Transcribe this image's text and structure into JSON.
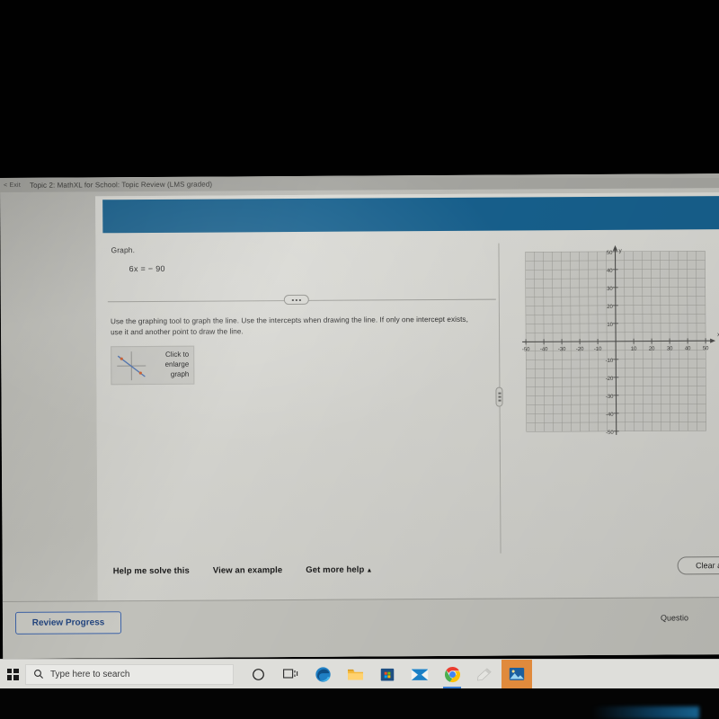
{
  "header": {
    "exit_label": "< Exit",
    "topic_title": "Topic 2: MathXL for School: Topic Review (LMS graded)"
  },
  "question": {
    "prompt": "Graph.",
    "equation": "6x = − 90",
    "instructions": "Use the graphing tool to graph the line. Use the intercepts when drawing the line. If only one intercept exists, use it and another point to draw the line.",
    "more_options_icon": "ellipsis-icon"
  },
  "enlarge_button": {
    "label": "Click to\nenlarge\ngraph",
    "line1": "Click to",
    "line2": "enlarge",
    "line3": "graph",
    "thumbnail_icon": "mini-graph-icon"
  },
  "splitter": {
    "icon": "drag-handle-icon"
  },
  "graph_tools": [
    {
      "name": "graph-tool-1",
      "glyph": "✎"
    },
    {
      "name": "graph-tool-2",
      "glyph": "•"
    },
    {
      "name": "graph-tool-3",
      "glyph": "↺"
    }
  ],
  "actions": {
    "help_me_solve": "Help me solve this",
    "view_example": "View an example",
    "get_more_help": "Get more help",
    "get_more_help_caret": "▲",
    "clear_all": "Clear a"
  },
  "footer": {
    "review_progress": "Review Progress",
    "question_status": "Questio"
  },
  "taskbar": {
    "start_icon": "windows-logo-icon",
    "search_placeholder": "Type here to search",
    "search_icon": "search-icon",
    "items": [
      {
        "name": "cortana-icon",
        "label": "Cortana"
      },
      {
        "name": "task-view-icon",
        "label": "Task View"
      },
      {
        "name": "edge-icon",
        "label": "Microsoft Edge"
      },
      {
        "name": "file-explorer-icon",
        "label": "File Explorer"
      },
      {
        "name": "microsoft-store-icon",
        "label": "Microsoft Store"
      },
      {
        "name": "mail-icon",
        "label": "Mail"
      },
      {
        "name": "chrome-icon",
        "label": "Google Chrome"
      },
      {
        "name": "snip-sketch-icon",
        "label": "Snip & Sketch"
      },
      {
        "name": "photos-icon",
        "label": "Photos"
      }
    ]
  },
  "colors": {
    "banner_blue": "#17608d",
    "review_blue": "#23457f",
    "photos_highlight": "#e08a3c",
    "chrome_active_underline": "#3a7fd5"
  },
  "chart_data": {
    "type": "scatter",
    "title": "",
    "xlabel": "x",
    "ylabel": "y",
    "xlim": [
      -50,
      50
    ],
    "ylim": [
      -50,
      50
    ],
    "xticks": [
      -50,
      -40,
      -30,
      -20,
      -10,
      10,
      20,
      30,
      40,
      50
    ],
    "yticks": [
      50,
      40,
      30,
      20,
      10,
      -10,
      -20,
      -30,
      -40,
      -50
    ],
    "grid": true,
    "grid_step": 5,
    "tick_label_step": 10,
    "axis_arrows": true,
    "series": [],
    "annotations": []
  }
}
